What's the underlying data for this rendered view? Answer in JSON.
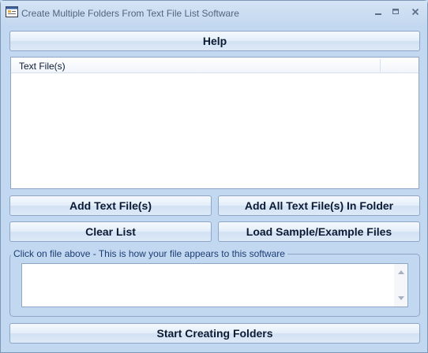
{
  "window": {
    "title": "Create Multiple Folders From Text File List Software",
    "controls": {
      "minimize": "–",
      "maximize": "▭",
      "close": "✕"
    }
  },
  "buttons": {
    "help": "Help",
    "add_text_files": "Add Text File(s)",
    "add_all_in_folder": "Add All Text File(s) In Folder",
    "clear_list": "Clear List",
    "load_sample": "Load Sample/Example Files",
    "start": "Start Creating Folders"
  },
  "list": {
    "column_header": "Text File(s)",
    "items": []
  },
  "preview": {
    "group_label": "Click on file above - This is how your file appears to this software",
    "content": ""
  },
  "icons": [
    "app-icon",
    "minimize-icon",
    "maximize-icon",
    "close-icon",
    "scroll-up-arrow-icon",
    "scroll-down-arrow-icon"
  ],
  "colors": {
    "window_bg": "#c2d7f0",
    "button_border": "#8ea6c6",
    "title_text": "#52657e",
    "group_label_text": "#1c3e74"
  }
}
